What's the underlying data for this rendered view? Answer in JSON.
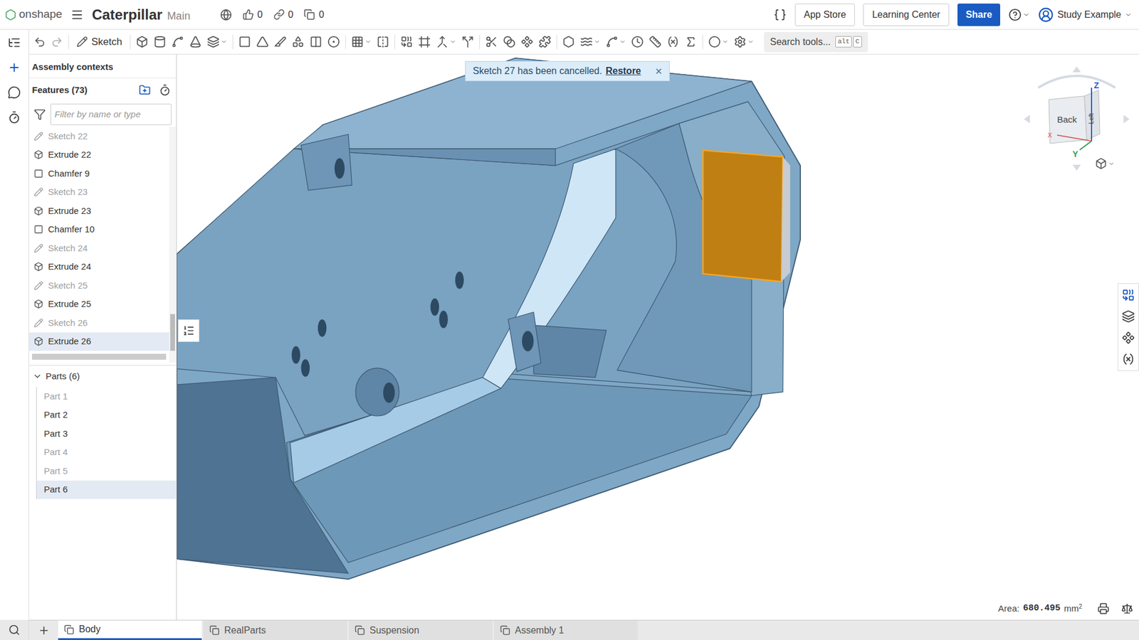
{
  "app": {
    "logo": "onshape",
    "document": "Caterpillar",
    "branch": "Main",
    "counters": [
      {
        "value": "0"
      },
      {
        "value": "0"
      },
      {
        "value": "0"
      }
    ],
    "buttons": [
      "App Store",
      "Learning Center"
    ],
    "share": "Share",
    "user": "Study Example"
  },
  "toolbar": {
    "sketch": "Sketch",
    "search": {
      "placeholder": "Search tools...",
      "shortcut": [
        "alt",
        "C"
      ]
    }
  },
  "notification": {
    "message": "Sketch 27 has been cancelled.",
    "action": "Restore",
    "close": "×"
  },
  "panel": {
    "contexts": "Assembly contexts",
    "features_title": "Features (73)",
    "filter_placeholder": "Filter by name or type",
    "features": [
      {
        "label": "Sketch 22",
        "kind": "sketch",
        "greyed": true,
        "selected": false
      },
      {
        "label": "Extrude 22",
        "kind": "extrude",
        "greyed": false,
        "selected": false
      },
      {
        "label": "Chamfer 9",
        "kind": "chamfer",
        "greyed": false,
        "selected": false
      },
      {
        "label": "Sketch 23",
        "kind": "sketch",
        "greyed": true,
        "selected": false
      },
      {
        "label": "Extrude 23",
        "kind": "extrude",
        "greyed": false,
        "selected": false
      },
      {
        "label": "Chamfer 10",
        "kind": "chamfer",
        "greyed": false,
        "selected": false
      },
      {
        "label": "Sketch 24",
        "kind": "sketch",
        "greyed": true,
        "selected": false
      },
      {
        "label": "Extrude 24",
        "kind": "extrude",
        "greyed": false,
        "selected": false
      },
      {
        "label": "Sketch 25",
        "kind": "sketch",
        "greyed": true,
        "selected": false
      },
      {
        "label": "Extrude 25",
        "kind": "extrude",
        "greyed": false,
        "selected": false
      },
      {
        "label": "Sketch 26",
        "kind": "sketch",
        "greyed": true,
        "selected": false
      },
      {
        "label": "Extrude 26",
        "kind": "extrude",
        "greyed": false,
        "selected": true
      }
    ],
    "parts_title": "Parts (6)",
    "parts_expanded": true,
    "parts": [
      {
        "label": "Part 1",
        "greyed": true,
        "selected": false
      },
      {
        "label": "Part 2",
        "greyed": false,
        "selected": false
      },
      {
        "label": "Part 3",
        "greyed": false,
        "selected": false
      },
      {
        "label": "Part 4",
        "greyed": true,
        "selected": false
      },
      {
        "label": "Part 5",
        "greyed": true,
        "selected": false
      },
      {
        "label": "Part 6",
        "greyed": false,
        "selected": true
      }
    ]
  },
  "viewcube": {
    "faces": [
      "Back",
      "Left"
    ],
    "axes": [
      {
        "label": "Z",
        "color": "#2a5bd7"
      },
      {
        "label": "Y",
        "color": "#2e9e4f"
      },
      {
        "label": "X",
        "color": "#d04a4a"
      }
    ]
  },
  "status": {
    "label": "Area:",
    "value": "680.495",
    "unit": "mm",
    "exponent": "2"
  },
  "tabs": [
    {
      "label": "Body",
      "selected": true
    },
    {
      "label": "RealParts",
      "selected": false
    },
    {
      "label": "Suspension",
      "selected": false
    },
    {
      "label": "Assembly 1",
      "selected": false
    }
  ]
}
